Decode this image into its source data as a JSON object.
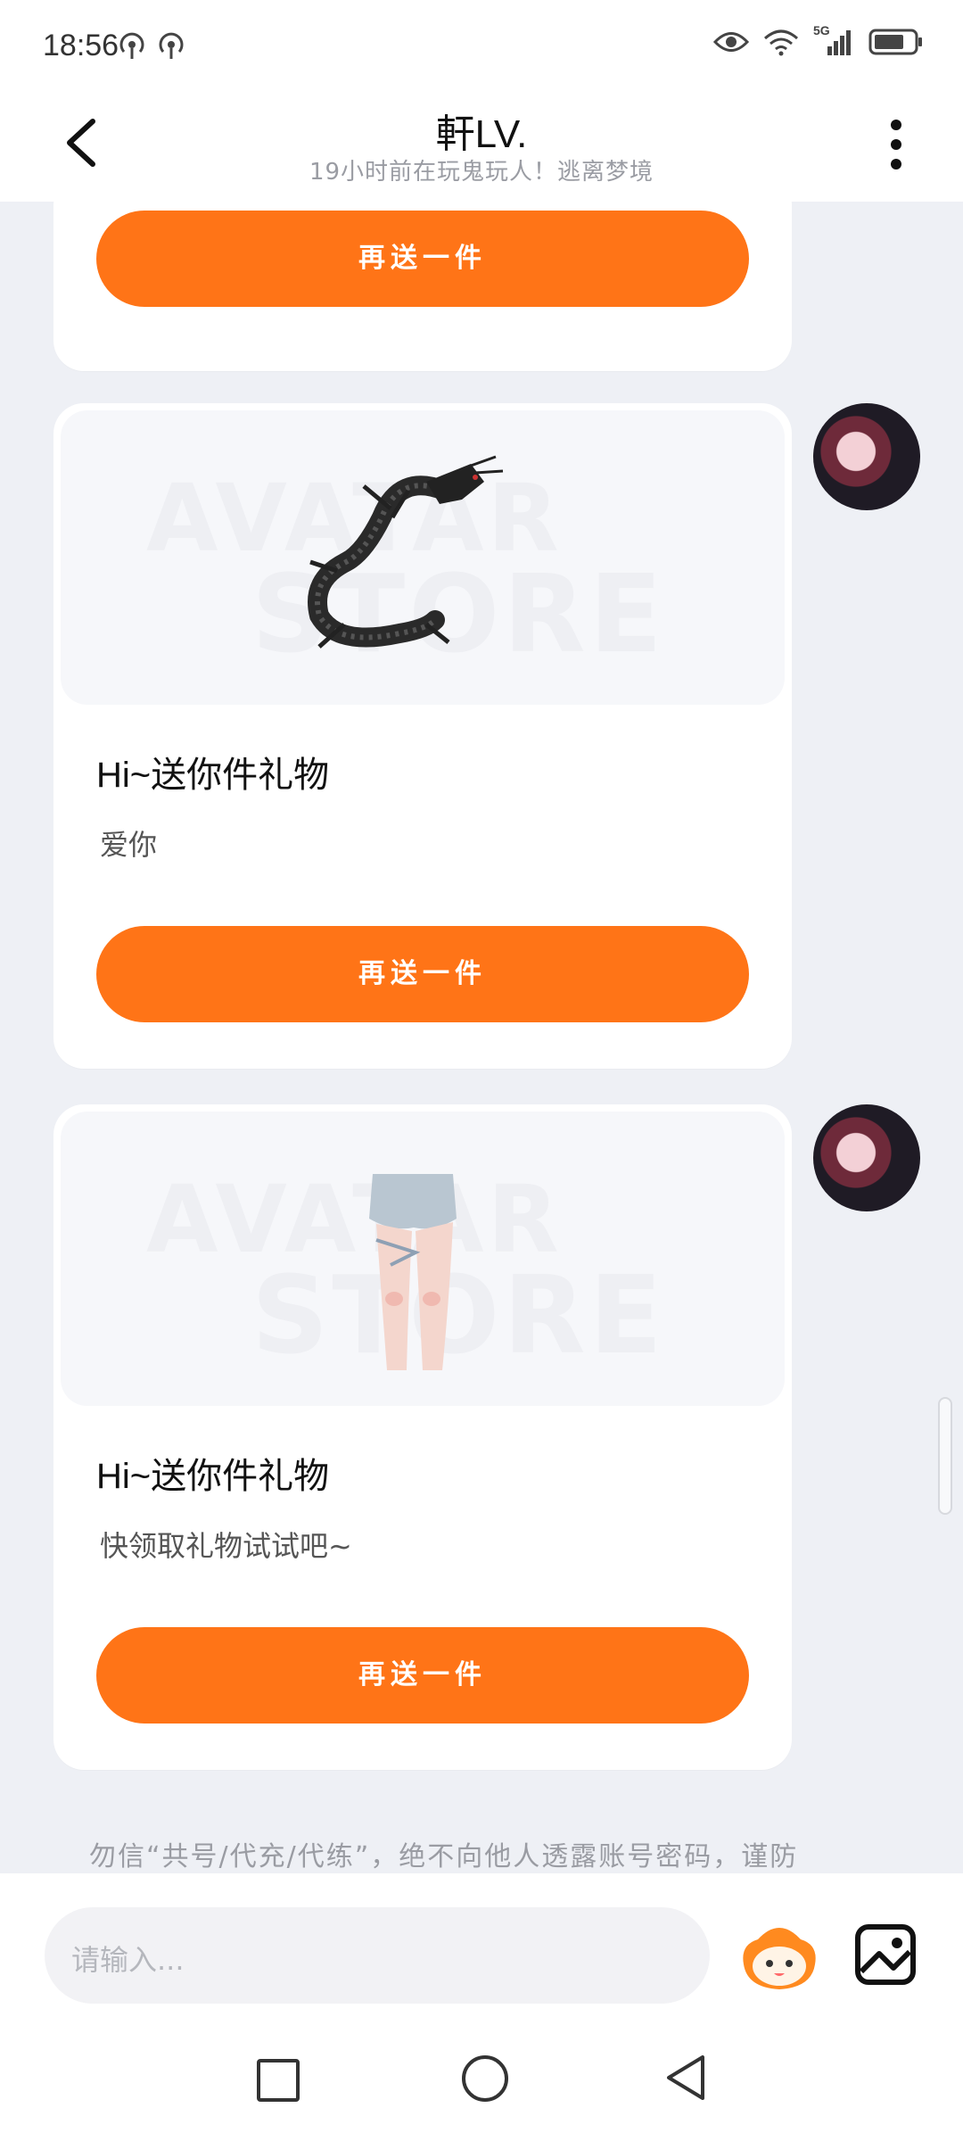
{
  "status_bar": {
    "time": "18:56",
    "network": "5G",
    "icons": [
      "hotspot-icon",
      "hotspot-icon",
      "eye-icon",
      "wifi-icon",
      "signal-icon",
      "battery-icon"
    ]
  },
  "header": {
    "title": "軒LV.",
    "subtitle": "19小时前在玩鬼玩人！逃离梦境"
  },
  "messages": [
    {
      "button_label": "再送一件"
    },
    {
      "gift": "black-dragon",
      "watermark_line1": "AVATAR",
      "watermark_line2": "STORE",
      "title": "Hi~送你件礼物",
      "message": "爱你",
      "button_label": "再送一件"
    },
    {
      "gift": "legs-with-shorts",
      "watermark_line1": "AVATAR",
      "watermark_line2": "STORE",
      "title": "Hi~送你件礼物",
      "message": "快领取礼物试试吧~",
      "button_label": "再送一件"
    }
  ],
  "notice": "勿信“共号/代充/代练”，绝不向他人透露账号密码，谨防",
  "input": {
    "placeholder": "请输入..."
  },
  "colors": {
    "accent": "#ff7417",
    "background": "#eef0f5"
  }
}
